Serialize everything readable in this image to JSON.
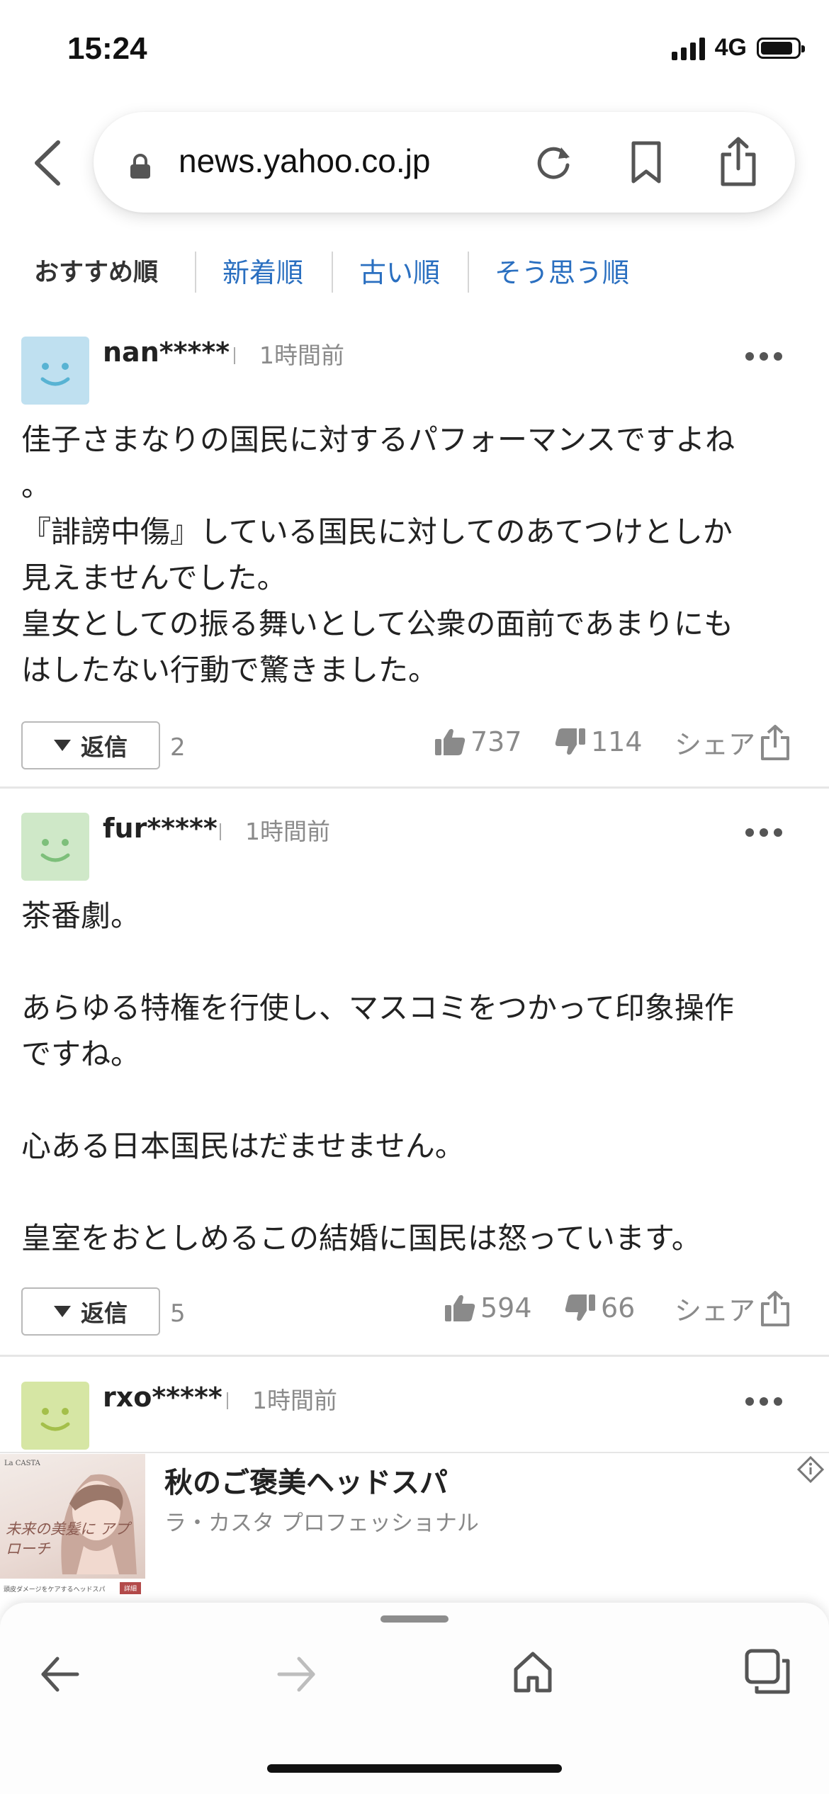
{
  "status_bar": {
    "time": "15:24",
    "network": "4G"
  },
  "browser": {
    "url": "news.yahoo.co.jp"
  },
  "sort_tabs": [
    {
      "label": "おすすめ順",
      "active": true
    },
    {
      "label": "新着順",
      "active": false
    },
    {
      "label": "古い順",
      "active": false
    },
    {
      "label": "そう思う順",
      "active": false
    }
  ],
  "comments": [
    {
      "user": "nan*****",
      "time": "1時間前",
      "avatar_color": "#bfe0f0",
      "body": "佳子さまなりの国民に対するパフォーマンスですよね\n。\n『誹謗中傷』している国民に対してのあてつけとしか\n見えませんでした。\n皇女としての振る舞いとして公衆の面前であまりにも\nはしたない行動で驚きました。",
      "reply_label": "返信",
      "reply_count": "2",
      "likes": "737",
      "dislikes": "114",
      "share_label": "シェア"
    },
    {
      "user": "fur*****",
      "time": "1時間前",
      "avatar_color": "#cfe8c8",
      "body": "茶番劇。\n\nあらゆる特権を行使し、マスコミをつかって印象操作\nですね。\n\n心ある日本国民はだませません。\n\n皇室をおとしめるこの結婚に国民は怒っています。",
      "reply_label": "返信",
      "reply_count": "5",
      "likes": "594",
      "dislikes": "66",
      "share_label": "シェア"
    },
    {
      "user": "rxo*****",
      "time": "1時間前",
      "avatar_color": "#d6e6a4"
    }
  ],
  "ad": {
    "title": "秋のご褒美ヘッドスパ",
    "subtitle": "ラ・カスタ プロフェッショナル",
    "image_brand": "La CASTA",
    "image_text": "未来の美髪に アプローチ",
    "image_caption": "頭皮ダメージをケアするヘッドスパ",
    "image_button": "詳細"
  },
  "colors": {
    "link_blue": "#2a6fc0",
    "meta_gray": "#8a8a8a"
  }
}
